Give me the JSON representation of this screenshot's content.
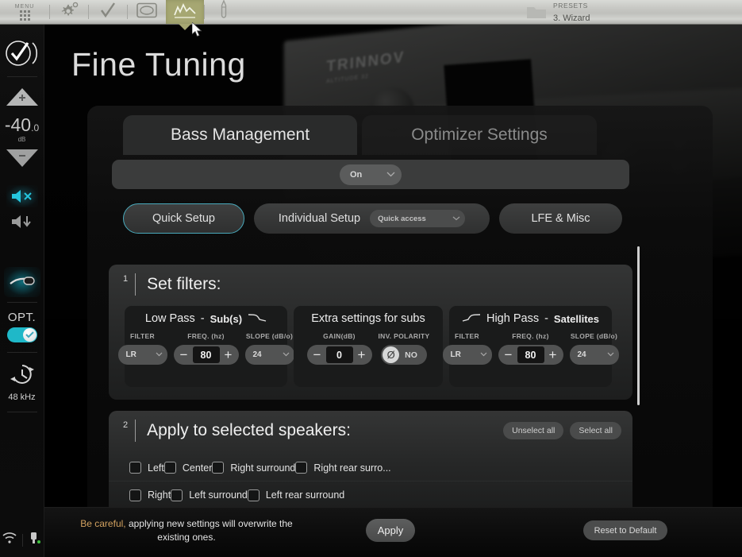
{
  "topbar": {
    "menu_label": "MENU",
    "items": [
      {
        "name": "menu-grid-icon",
        "label": "MENU"
      },
      {
        "name": "gear-icon",
        "label": "Setup"
      },
      {
        "name": "checkmark-icon",
        "label": "Calibration"
      },
      {
        "name": "screen-icon",
        "label": "Display"
      },
      {
        "name": "waveform-chart-icon",
        "label": "Fine Tuning"
      },
      {
        "name": "pen-icon",
        "label": "Tools"
      }
    ],
    "presets_title": "PRESETS",
    "presets_value": "3. Wizard"
  },
  "sidebar": {
    "logo_name": "trinnov-logo",
    "volume_up": "+",
    "volume_down": "−",
    "level_int": "-40",
    "level_dec": ".0",
    "level_unit": "dB",
    "mute_name": "mute-icon",
    "dim_name": "dim-icon",
    "mic_name": "microphone-icon",
    "opt_label": "OPT.",
    "toggle_state": "on",
    "clock_name": "sync-clock-icon",
    "sample_rate": "48 kHz",
    "wifi_name": "wifi-icon",
    "usb_name": "usb-icon"
  },
  "page": {
    "title": "Fine Tuning",
    "background_brand": "TRINNOV",
    "background_brand_sub": "ALTITUDE 32"
  },
  "tabs": [
    {
      "label": "Bass Management",
      "active": true
    },
    {
      "label": "Optimizer Settings",
      "active": false
    }
  ],
  "mode_dropdown": {
    "value": "On",
    "chevron": "⌄"
  },
  "setup_buttons": {
    "quick_setup": "Quick Setup",
    "individual_setup": "Individual Setup",
    "quick_access": "Quick access",
    "lfe_misc": "LFE & Misc"
  },
  "section1": {
    "number": "1",
    "title": "Set filters:",
    "boxes": [
      {
        "name": "low-pass-subs",
        "title_main": "Low Pass",
        "title_sep": "-",
        "title_sub": "Sub(s)",
        "icon": "lowpass-curve-icon",
        "icon_side": "right",
        "fields": [
          {
            "label": "FILTER",
            "type": "select",
            "value": "LR"
          },
          {
            "label": "FREQ. (hz)",
            "type": "stepper",
            "value": "80",
            "minus": "−",
            "plus": "+"
          },
          {
            "label": "SLOPE (dB/o)",
            "type": "select",
            "value": "24"
          }
        ]
      },
      {
        "name": "extra-settings-subs",
        "title_main": "Extra settings for subs",
        "title_sep": "",
        "title_sub": "",
        "icon": "",
        "icon_side": "",
        "fields": [
          {
            "label": "GAIN(dB)",
            "type": "stepper",
            "value": "0",
            "minus": "−",
            "plus": "+"
          },
          {
            "label": "INV. POLARITY",
            "type": "polarity",
            "value": "NO",
            "symbol": "Ø"
          }
        ]
      },
      {
        "name": "high-pass-satellites",
        "title_main": "High Pass",
        "title_sep": "-",
        "title_sub": "Satellites",
        "icon": "highpass-curve-icon",
        "icon_side": "left",
        "fields": [
          {
            "label": "FILTER",
            "type": "select",
            "value": "LR"
          },
          {
            "label": "FREQ. (hz)",
            "type": "stepper",
            "value": "80",
            "minus": "−",
            "plus": "+"
          },
          {
            "label": "SLOPE (dB/o)",
            "type": "select",
            "value": "24"
          }
        ]
      }
    ]
  },
  "section2": {
    "number": "2",
    "title": "Apply to selected speakers:",
    "unselect_all": "Unselect all",
    "select_all": "Select all",
    "speakers_row1": [
      "Left",
      "Center",
      "Right surround",
      "Right rear surro..."
    ],
    "speakers_row2": [
      "Right",
      "Left surround",
      "Left rear surround"
    ]
  },
  "footer": {
    "warning_bold": "Be careful,",
    "warning_rest": " applying new settings will overwrite the existing ones.",
    "apply": "Apply",
    "reset": "Reset to Default"
  },
  "colors": {
    "accent_cyan": "#49a9bb",
    "topbar_active": "#a6a772",
    "warning_amber": "#d2a15f"
  }
}
